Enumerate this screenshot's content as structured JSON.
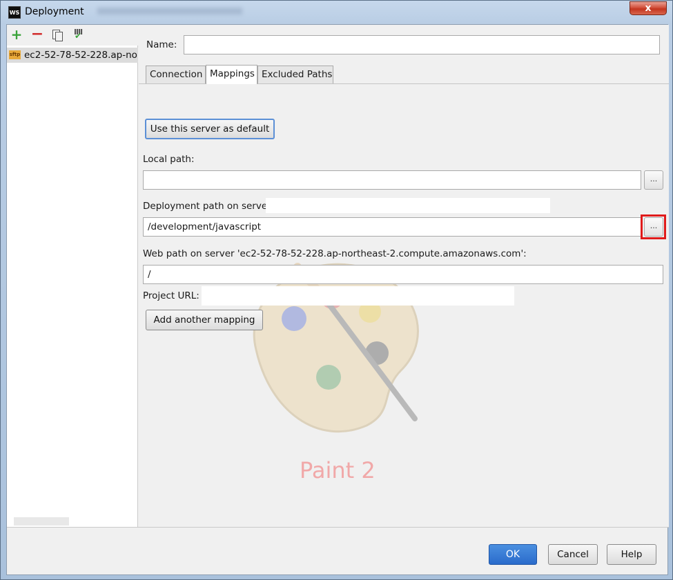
{
  "window": {
    "title": "Deployment",
    "app_icon_text": "WS",
    "close_glyph": "x"
  },
  "left": {
    "toolbar": {
      "add_glyph": "+",
      "remove_glyph": "−"
    },
    "server_items": [
      {
        "icon_text": "sftp",
        "label": "ec2-52-78-52-228.ap-no"
      }
    ]
  },
  "form": {
    "name_label": "Name:",
    "name_value": "",
    "tabs": [
      {
        "label": "Connection",
        "active": false
      },
      {
        "label": "Mappings",
        "active": true
      },
      {
        "label": "Excluded Paths",
        "active": false
      }
    ],
    "mappings": {
      "use_default_button": "Use this server as default",
      "local_path_label": "Local path:",
      "local_path_value": "",
      "deployment_path_label": "Deployment path on server",
      "deployment_path_value": "/development/javascript",
      "web_path_label": "Web path on server 'ec2-52-78-52-228.ap-northeast-2.compute.amazonaws.com':",
      "web_path_value": "/",
      "project_url_label": "Project URL:",
      "add_mapping_button": "Add another mapping",
      "browse_label": "..."
    }
  },
  "watermark": {
    "text": "Paint 2"
  },
  "footer": {
    "ok": "OK",
    "cancel": "Cancel",
    "help": "Help"
  },
  "colors": {
    "highlight": "#e01b1b",
    "ok_button": "#2a6bcb"
  }
}
